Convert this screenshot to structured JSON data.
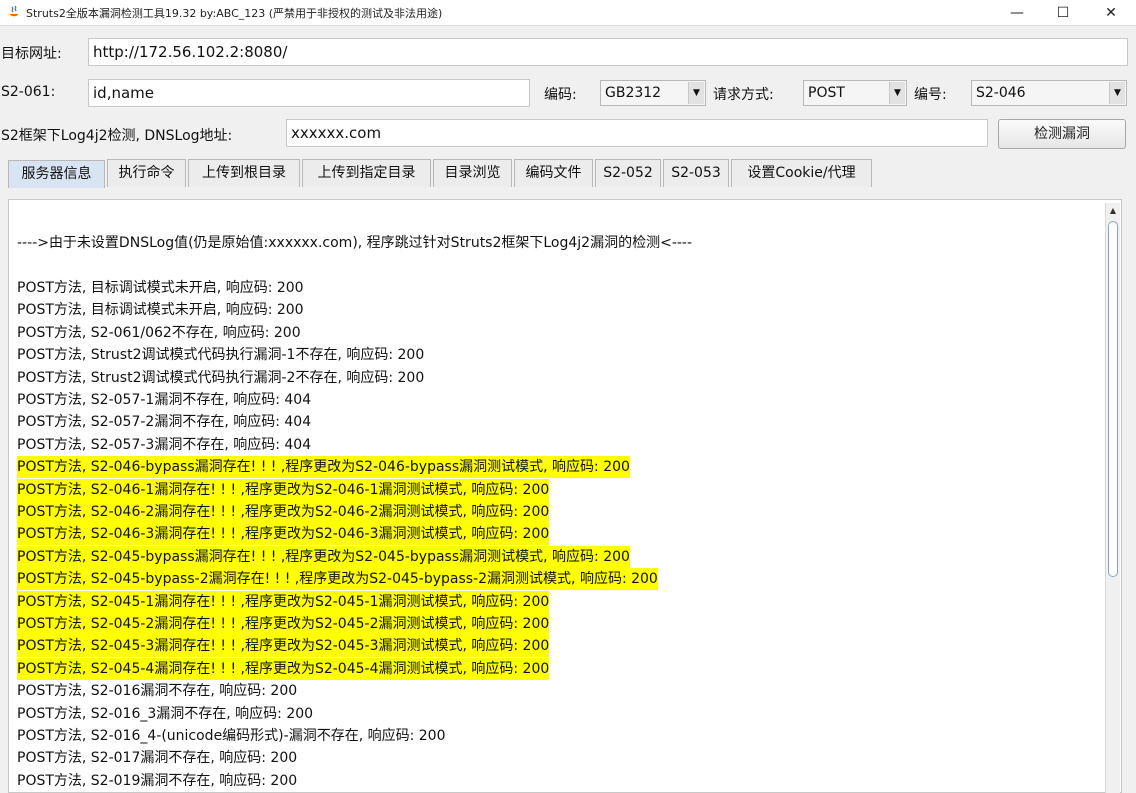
{
  "window": {
    "title": "Struts2全版本漏洞检测工具19.32 by:ABC_123  (严禁用于非授权的测试及非法用途)",
    "minimize": "—",
    "maximize": "☐",
    "close": "✕"
  },
  "form": {
    "target_label": "目标网址:",
    "target_value": "http://172.56.102.2:8080/",
    "s2061_label": "S2-061:",
    "s2061_value": "id,name",
    "encoding_label": "编码:",
    "encoding_value": "GB2312",
    "method_label": "请求方式:",
    "method_value": "POST",
    "number_label": "编号:",
    "number_value": "S2-046",
    "log4j_label": "S2框架下Log4j2检测,  DNSLog地址:",
    "dnslog_value": "xxxxxx.com",
    "detect_button": "检测漏洞"
  },
  "tabs": [
    "服务器信息",
    "执行命令",
    "上传到根目录",
    "上传到指定目录",
    "目录浏览",
    "编码文件",
    "S2-052",
    "S2-053",
    "设置Cookie/代理"
  ],
  "active_tab": "服务器信息",
  "highlight_color": "#ffff00",
  "output": {
    "notice": "---->由于未设置DNSLog值(仍是原始值:xxxxxx.com),  程序跳过针对Struts2框架下Log4j2漏洞的检测<----",
    "lines": [
      {
        "text": "POST方法,  目标调试模式未开启, 响应码: 200",
        "highlight": false
      },
      {
        "text": "POST方法,  目标调试模式未开启, 响应码: 200",
        "highlight": false
      },
      {
        "text": "POST方法,  S2-061/062不存在, 响应码: 200",
        "highlight": false
      },
      {
        "text": "POST方法,  Strust2调试模式代码执行漏洞-1不存在, 响应码: 200",
        "highlight": false
      },
      {
        "text": "POST方法,  Strust2调试模式代码执行漏洞-2不存在, 响应码: 200",
        "highlight": false
      },
      {
        "text": "POST方法,  S2-057-1漏洞不存在, 响应码: 404",
        "highlight": false
      },
      {
        "text": "POST方法,  S2-057-2漏洞不存在, 响应码: 404",
        "highlight": false
      },
      {
        "text": "POST方法,  S2-057-3漏洞不存在, 响应码: 404",
        "highlight": false
      },
      {
        "text": "POST方法,  S2-046-bypass漏洞存在! ! !  ,程序更改为S2-046-bypass漏洞测试模式, 响应码: 200",
        "highlight": true
      },
      {
        "text": "POST方法,  S2-046-1漏洞存在! ! !  ,程序更改为S2-046-1漏洞测试模式, 响应码: 200",
        "highlight": true
      },
      {
        "text": "POST方法,  S2-046-2漏洞存在! ! !  ,程序更改为S2-046-2漏洞测试模式, 响应码: 200",
        "highlight": true
      },
      {
        "text": "POST方法,  S2-046-3漏洞存在! ! !  ,程序更改为S2-046-3漏洞测试模式, 响应码: 200",
        "highlight": true
      },
      {
        "text": "POST方法,  S2-045-bypass漏洞存在! ! !  ,程序更改为S2-045-bypass漏洞测试模式, 响应码: 200",
        "highlight": true
      },
      {
        "text": "POST方法,  S2-045-bypass-2漏洞存在! ! !  ,程序更改为S2-045-bypass-2漏洞测试模式, 响应码: 200",
        "highlight": true
      },
      {
        "text": "POST方法,  S2-045-1漏洞存在! ! !  ,程序更改为S2-045-1漏洞测试模式, 响应码: 200",
        "highlight": true
      },
      {
        "text": "POST方法,  S2-045-2漏洞存在! ! !  ,程序更改为S2-045-2漏洞测试模式, 响应码: 200",
        "highlight": true
      },
      {
        "text": "POST方法,  S2-045-3漏洞存在! ! !  ,程序更改为S2-045-3漏洞测试模式, 响应码: 200",
        "highlight": true
      },
      {
        "text": "POST方法,  S2-045-4漏洞存在! ! !  ,程序更改为S2-045-4漏洞测试模式, 响应码: 200",
        "highlight": true
      },
      {
        "text": "POST方法,  S2-016漏洞不存在, 响应码: 200",
        "highlight": false
      },
      {
        "text": "POST方法,  S2-016_3漏洞不存在, 响应码: 200",
        "highlight": false
      },
      {
        "text": "POST方法,  S2-016_4-(unicode编码形式)-漏洞不存在, 响应码: 200",
        "highlight": false
      },
      {
        "text": "POST方法,  S2-017漏洞不存在, 响应码: 200",
        "highlight": false
      },
      {
        "text": "POST方法,  S2-019漏洞不存在, 响应码: 200",
        "highlight": false
      }
    ]
  }
}
